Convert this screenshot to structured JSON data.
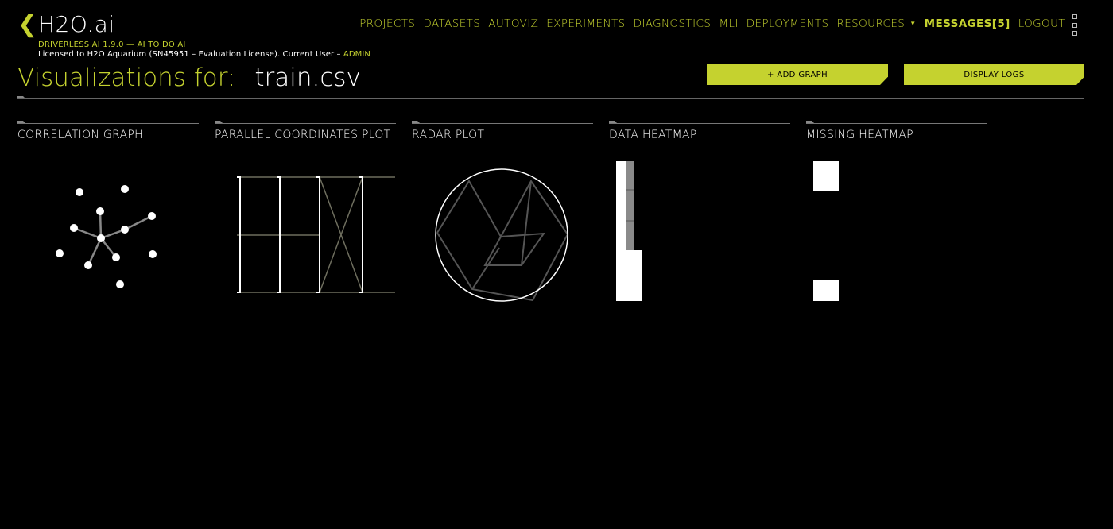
{
  "header": {
    "logo_chevron": "❮",
    "logo_text": "H2O.ai",
    "version_line": "DRIVERLESS AI 1.9.0 — AI TO DO AI",
    "license_prefix": "Licensed to H2O Aquarium (SN45951 – Evaluation License). Current User – ",
    "current_user": "ADMIN"
  },
  "nav": {
    "items": [
      "PROJECTS",
      "DATASETS",
      "AUTOVIZ",
      "EXPERIMENTS",
      "DIAGNOSTICS",
      "MLI",
      "DEPLOYMENTS",
      "RESOURCES"
    ],
    "resources_caret": "▼",
    "messages": "MESSAGES[5]",
    "logout": "LOGOUT"
  },
  "page": {
    "title_prefix": "Visualizations for:",
    "filename": "train.csv"
  },
  "actions": {
    "add_graph": "+ ADD GRAPH",
    "display_logs": "DISPLAY LOGS"
  },
  "cards": [
    {
      "title": "CORRELATION GRAPH",
      "icon": "correlation-graph-thumbnail"
    },
    {
      "title": "PARALLEL COORDINATES PLOT",
      "icon": "parallel-coordinates-thumbnail"
    },
    {
      "title": "RADAR PLOT",
      "icon": "radar-plot-thumbnail"
    },
    {
      "title": "DATA HEATMAP",
      "icon": "data-heatmap-thumbnail"
    },
    {
      "title": "MISSING HEATMAP",
      "icon": "missing-heatmap-thumbnail"
    }
  ],
  "colors": {
    "accent": "#c5d22f",
    "background": "#000000",
    "text": "#ffffff"
  }
}
